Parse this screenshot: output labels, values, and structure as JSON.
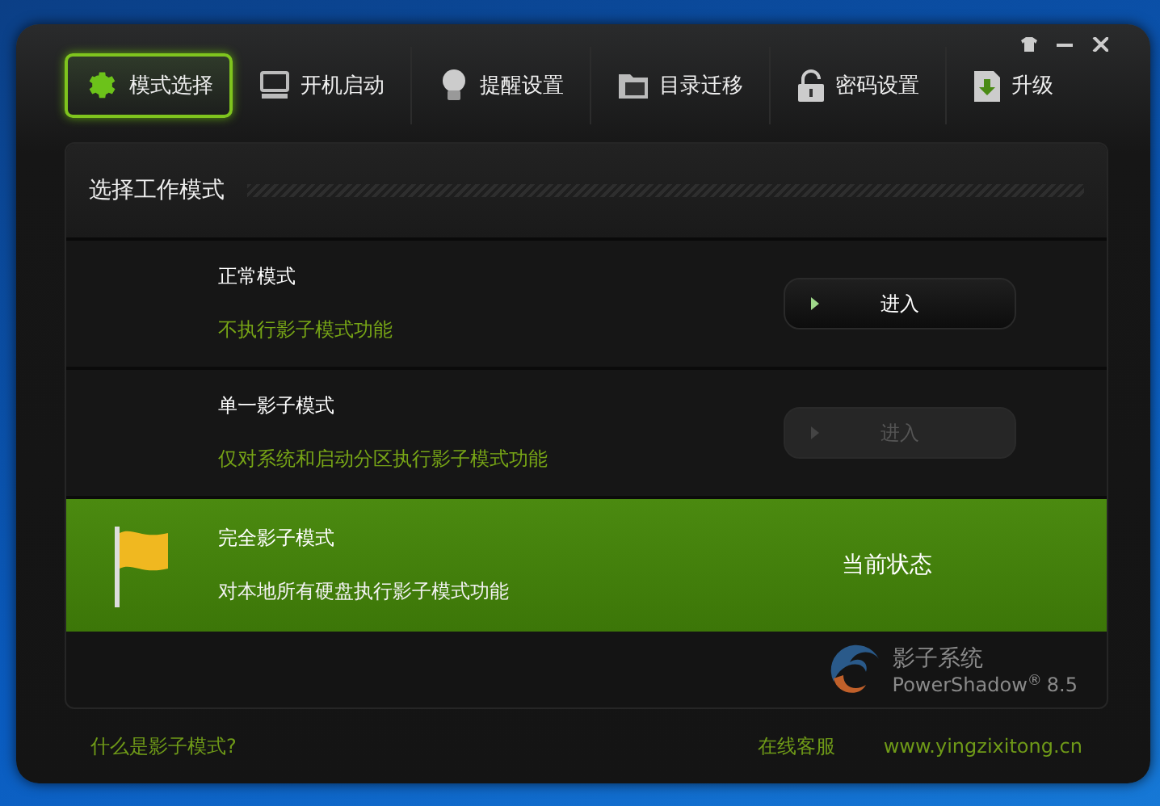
{
  "tabs": [
    {
      "label": "模式选择",
      "kind": "gear",
      "selected": true
    },
    {
      "label": "开机启动",
      "kind": "monitor",
      "selected": false
    },
    {
      "label": "提醒设置",
      "kind": "bulb",
      "selected": false
    },
    {
      "label": "目录迁移",
      "kind": "folder",
      "selected": false
    },
    {
      "label": "密码设置",
      "kind": "lock",
      "selected": false
    },
    {
      "label": "升级",
      "kind": "download",
      "selected": false
    }
  ],
  "panel": {
    "title": "选择工作模式",
    "modes": [
      {
        "title": "正常模式",
        "description": "不执行影子模式功能",
        "selected": false,
        "action": {
          "kind": "button",
          "label": "进入",
          "disabled": false
        }
      },
      {
        "title": "单一影子模式",
        "description": "仅对系统和启动分区执行影子模式功能",
        "selected": false,
        "action": {
          "kind": "button",
          "label": "进入",
          "disabled": true
        }
      },
      {
        "title": "完全影子模式",
        "description": "对本地所有硬盘执行影子模式功能",
        "selected": true,
        "action": {
          "kind": "status",
          "label": "当前状态"
        }
      }
    ],
    "logo": {
      "name": "影子系统",
      "product": "PowerShadow",
      "mark": "®",
      "version": "8.5"
    }
  },
  "footer": {
    "help_link": "什么是影子模式?",
    "support_link": "在线客服",
    "website": "www.yingzixitong.cn"
  }
}
